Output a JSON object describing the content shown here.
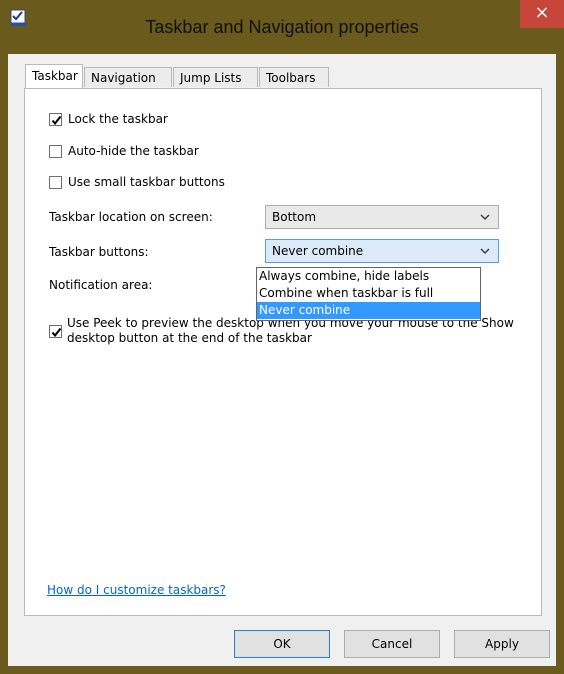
{
  "window": {
    "title": "Taskbar and Navigation properties",
    "close_glyph": "×",
    "frame_color": "#6a5a1c",
    "close_color": "#c7463a"
  },
  "tabs": [
    {
      "label": "Taskbar",
      "active": true
    },
    {
      "label": "Navigation",
      "active": false
    },
    {
      "label": "Jump Lists",
      "active": false
    },
    {
      "label": "Toolbars",
      "active": false
    }
  ],
  "checkboxes": {
    "lock": {
      "label": "Lock the taskbar",
      "checked": true
    },
    "autohide": {
      "label": "Auto-hide the taskbar",
      "checked": false
    },
    "small_buttons": {
      "label": "Use small taskbar buttons",
      "checked": false
    },
    "peek": {
      "label": "Use Peek to preview the desktop when you move your mouse to the Show desktop button at the end of the taskbar",
      "checked": true
    }
  },
  "location": {
    "label": "Taskbar location on screen:",
    "value": "Bottom"
  },
  "buttons_combine": {
    "label": "Taskbar buttons:",
    "value": "Never combine",
    "options": [
      "Always combine, hide labels",
      "Combine when taskbar is full",
      "Never combine"
    ],
    "selected_index": 2
  },
  "notification": {
    "label": "Notification area:"
  },
  "help_link": "How do I customize taskbars?",
  "footer": {
    "ok": "OK",
    "cancel": "Cancel",
    "apply": "Apply"
  },
  "accent": "#3399ff",
  "link_color": "#0066cc"
}
